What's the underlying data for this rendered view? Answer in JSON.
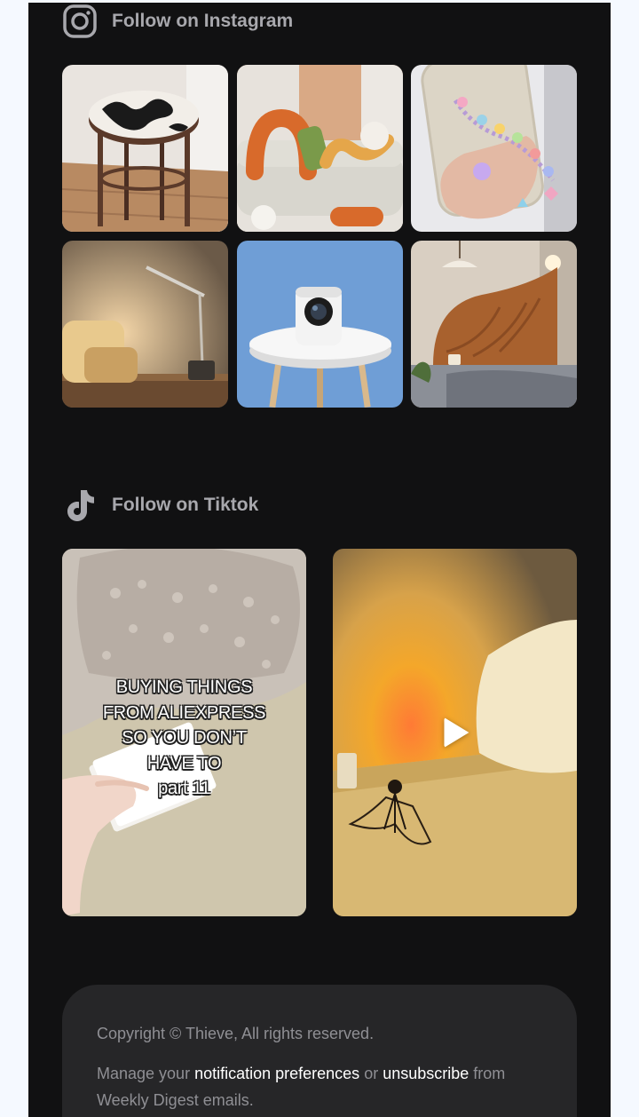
{
  "instagram": {
    "label": "Follow on Instagram",
    "icon": "instagram-icon",
    "posts": [
      {
        "name": "ig-post-stool"
      },
      {
        "name": "ig-post-sofa-pillows"
      },
      {
        "name": "ig-post-phone-charm"
      },
      {
        "name": "ig-post-desk-lamp"
      },
      {
        "name": "ig-post-projector"
      },
      {
        "name": "ig-post-headboard-cushion"
      }
    ]
  },
  "tiktok": {
    "label": "Follow on Tiktok",
    "icon": "tiktok-icon",
    "videos": [
      {
        "caption": "BUYING THINGS\nFROM ALIEXPRESS\nSO YOU DON’T\nHAVE TO\npart 11"
      },
      {
        "play_icon": "play-icon"
      }
    ]
  },
  "footer": {
    "copyright": "Copyright © Thieve, All rights reserved.",
    "manage_prefix": "Manage your ",
    "notification_link": "notification preferences",
    "or_text": " or ",
    "unsubscribe_link": "unsubscribe",
    "suffix": " from Weekly Digest emails."
  },
  "colors": {
    "page_background": "#f5f9ff",
    "panel_background": "#111112",
    "heading_text": "#a8a8ad",
    "footer_background": "#262628",
    "footer_text": "#8f8f94",
    "link_text": "#ffffff"
  }
}
